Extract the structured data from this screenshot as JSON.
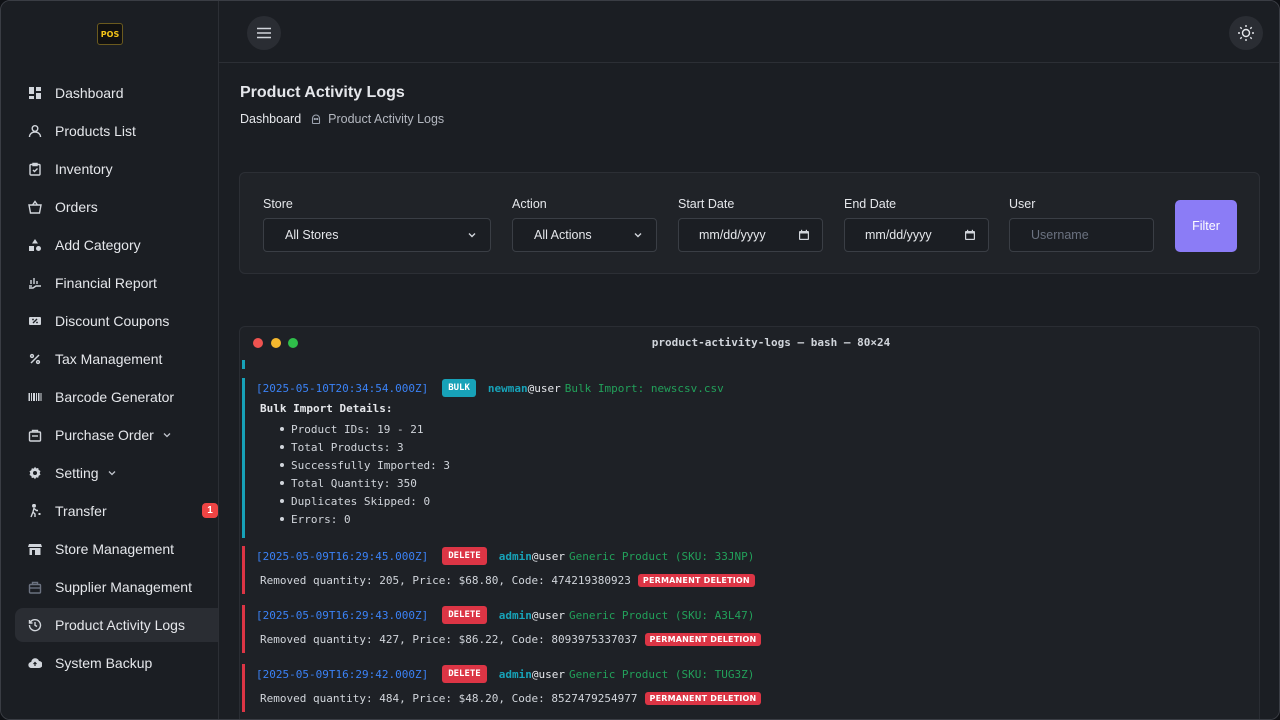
{
  "app": {
    "logo_text": "POS"
  },
  "sidebar": {
    "items": [
      {
        "label": "Dashboard",
        "icon": "dashboard-icon"
      },
      {
        "label": "Products List",
        "icon": "user-icon"
      },
      {
        "label": "Inventory",
        "icon": "clipboard-icon"
      },
      {
        "label": "Orders",
        "icon": "basket-icon"
      },
      {
        "label": "Add Category",
        "icon": "shapes-icon"
      },
      {
        "label": "Financial Report",
        "icon": "chart-hand-icon"
      },
      {
        "label": "Discount Coupons",
        "icon": "coupon-icon"
      },
      {
        "label": "Tax Management",
        "icon": "percent-icon"
      },
      {
        "label": "Barcode Generator",
        "icon": "barcode-icon"
      },
      {
        "label": "Purchase Order",
        "icon": "purchase-icon"
      },
      {
        "label": "Setting",
        "icon": "gear-icon"
      },
      {
        "label": "Transfer",
        "icon": "walk-icon",
        "badge": "1"
      },
      {
        "label": "Store Management",
        "icon": "store-icon"
      },
      {
        "label": "Supplier Management",
        "icon": "bag-icon"
      },
      {
        "label": "Product Activity Logs",
        "icon": "history-icon"
      },
      {
        "label": "System Backup",
        "icon": "cloud-upload-icon"
      }
    ]
  },
  "header": {
    "title": "Product Activity Logs",
    "breadcrumb": {
      "home": "Dashboard",
      "current": "Product Activity Logs"
    }
  },
  "filters": {
    "store": {
      "label": "Store",
      "value": "All Stores"
    },
    "action": {
      "label": "Action",
      "value": "All Actions"
    },
    "start_date": {
      "label": "Start Date",
      "value": "mm/dd/yyyy"
    },
    "end_date": {
      "label": "End Date",
      "value": "mm/dd/yyyy"
    },
    "user": {
      "label": "User",
      "placeholder": "Username"
    },
    "filter_button": "Filter"
  },
  "terminal": {
    "title": "product-activity-logs — bash — 80×24",
    "bulk_entry": {
      "timestamp": "[2025-05-10T20:34:54.000Z]",
      "tag": "BULK",
      "user": "newman",
      "at": "@user",
      "message": "Bulk Import: newscsv.csv",
      "details_title": "Bulk Import Details:",
      "details": [
        "Product IDs: 19 - 21",
        "Total Products: 3",
        "Successfully Imported: 3",
        "Total Quantity: 350",
        "Duplicates Skipped: 0",
        "Errors: 0"
      ]
    },
    "delete_entries": [
      {
        "timestamp": "[2025-05-09T16:29:45.000Z]",
        "tag": "DELETE",
        "user": "admin",
        "at": "@user",
        "message": "Generic Product (SKU: 33JNP)",
        "detail": "Removed quantity: 205, Price: $68.80, Code: 474219380923",
        "badge": "PERMANENT DELETION"
      },
      {
        "timestamp": "[2025-05-09T16:29:43.000Z]",
        "tag": "DELETE",
        "user": "admin",
        "at": "@user",
        "message": "Generic Product (SKU: A3L47)",
        "detail": "Removed quantity: 427, Price: $86.22, Code: 8093975337037",
        "badge": "PERMANENT DELETION"
      },
      {
        "timestamp": "[2025-05-09T16:29:42.000Z]",
        "tag": "DELETE",
        "user": "admin",
        "at": "@user",
        "message": "Generic Product (SKU: TUG3Z)",
        "detail": "Removed quantity: 484, Price: $48.20, Code: 8527479254977",
        "badge": "PERMANENT DELETION"
      }
    ]
  }
}
